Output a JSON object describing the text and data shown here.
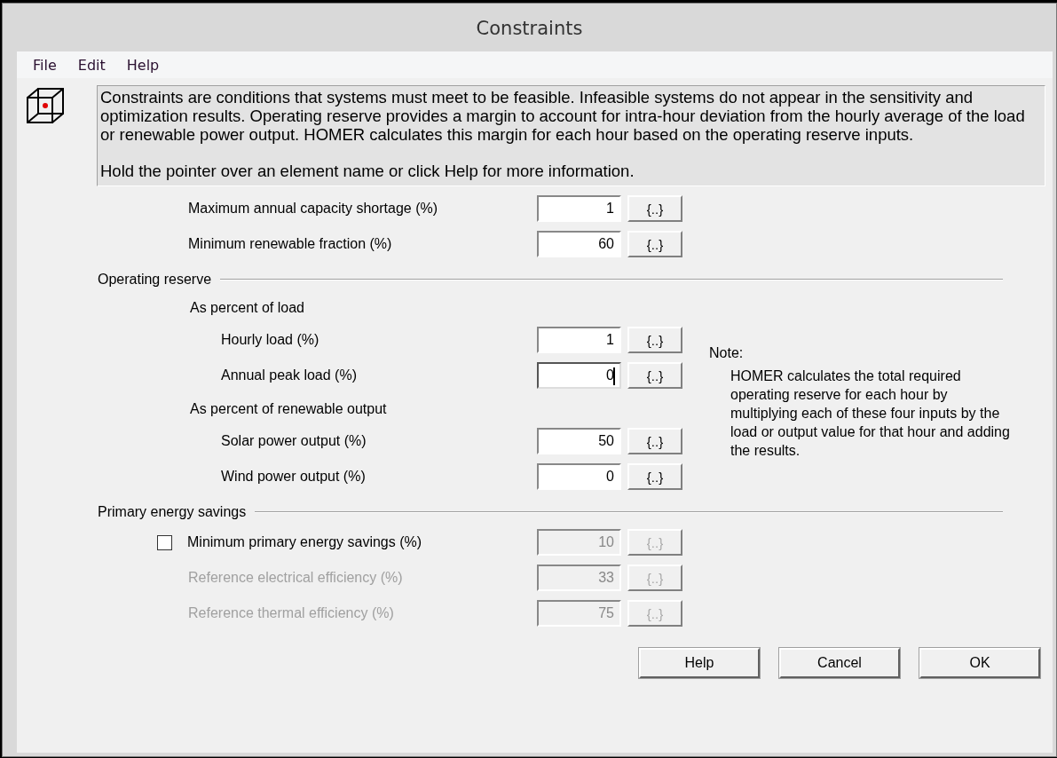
{
  "window": {
    "title": "Constraints"
  },
  "menu": [
    "File",
    "Edit",
    "Help"
  ],
  "description": {
    "paragraphs": [
      "Constraints are conditions that systems must meet to be feasible. Infeasible systems do not appear in the sensitivity and optimization results. Operating reserve provides a margin to account for intra-hour deviation from the hourly average of the load or renewable power output. HOMER calculates this margin for each hour based on the operating reserve inputs.",
      "Hold the pointer over an element name or click Help for more information."
    ]
  },
  "constraints": [
    {
      "label": "Maximum annual capacity shortage (%)",
      "value": "1",
      "disabled": false,
      "focused": false
    },
    {
      "label": "Minimum renewable fraction (%)",
      "value": "60",
      "disabled": false,
      "focused": false
    }
  ],
  "operating_reserve": {
    "heading": "Operating reserve",
    "groups": [
      {
        "heading": "As percent of load",
        "rows": [
          {
            "label": "Hourly load (%)",
            "value": "1",
            "disabled": false,
            "focused": false
          },
          {
            "label": "Annual peak load (%)",
            "value": "0",
            "disabled": false,
            "focused": true
          }
        ]
      },
      {
        "heading": "As percent of renewable output",
        "rows": [
          {
            "label": "Solar power output (%)",
            "value": "50",
            "disabled": false,
            "focused": false
          },
          {
            "label": "Wind power output (%)",
            "value": "0",
            "disabled": false,
            "focused": false
          }
        ]
      }
    ],
    "note": {
      "title": "Note:",
      "text": "HOMER calculates the total required operating reserve for each hour by multiplying each of these four inputs by the load or output value for that hour and adding the results."
    }
  },
  "primary_energy": {
    "heading": "Primary energy savings",
    "checkbox": {
      "label": "Minimum primary energy savings (%)",
      "checked": false,
      "value": "10",
      "disabled": true
    },
    "rows": [
      {
        "label": "Reference electrical efficiency (%)",
        "value": "33",
        "disabled": true,
        "focused": false
      },
      {
        "label": "Reference thermal efficiency (%)",
        "value": "75",
        "disabled": true,
        "focused": false
      }
    ]
  },
  "edit_button_label": "{..}",
  "buttons": [
    "Help",
    "Cancel",
    "OK"
  ]
}
